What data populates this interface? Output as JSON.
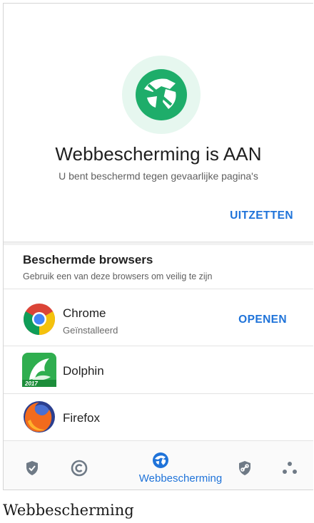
{
  "hero": {
    "title": "Webbescherming is AAN",
    "subtitle": "U bent beschermd tegen gevaarlijke pagina's",
    "turn_off_label": "UITZETTEN"
  },
  "browsers_section": {
    "title": "Beschermde browsers",
    "subtitle": "Gebruik een van deze browsers om veilig te zijn",
    "items": [
      {
        "name": "Chrome",
        "status": "Geïnstalleerd",
        "action": "OPENEN",
        "icon": "chrome-icon"
      },
      {
        "name": "Dolphin",
        "icon": "dolphin-icon",
        "icon_badge": "2017"
      },
      {
        "name": "Firefox",
        "icon": "firefox-icon"
      }
    ]
  },
  "bottom_nav": {
    "active_label": "Webbescherming",
    "items": [
      {
        "icon": "shield-check-icon"
      },
      {
        "icon": "circle-c-icon"
      },
      {
        "icon": "web-protection-icon",
        "label": "Webbescherming"
      },
      {
        "icon": "shield-link-icon"
      },
      {
        "icon": "dots-icon"
      }
    ]
  },
  "caption": "Webbescherming",
  "colors": {
    "accent": "#1f73d9",
    "brand_green": "#1ead6a",
    "badge_bg": "#e6f7ef",
    "nav_icon_gray": "#6f7a86"
  }
}
